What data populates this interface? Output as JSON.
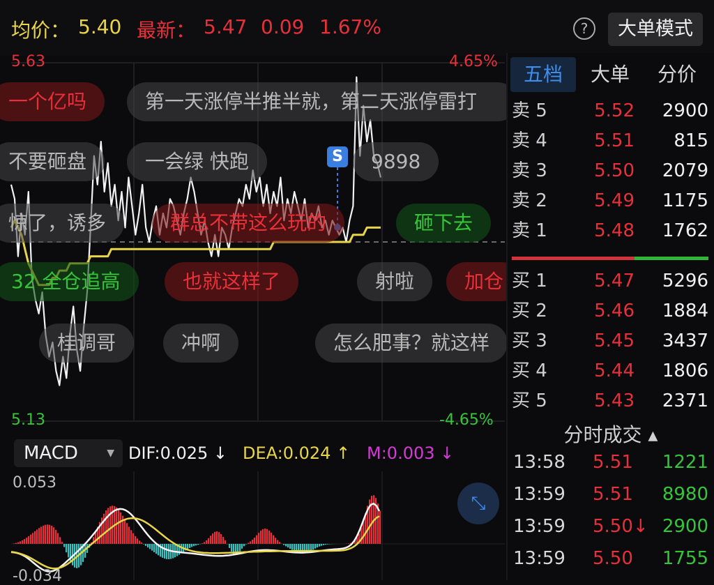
{
  "header": {
    "avg_label": "均价：",
    "avg_value": "5.40",
    "latest_label": "最新：",
    "latest_price": "5.47",
    "change": "0.09",
    "change_pct": "1.67%",
    "help_icon": "?",
    "mode_button": "大单模式"
  },
  "chart_data": {
    "type": "line",
    "price_max": "5.63",
    "price_min": "5.13",
    "pct_max": "4.65%",
    "pct_min": "-4.65%",
    "ylim": [
      5.13,
      5.63
    ],
    "prev_close": 5.38,
    "series": [
      {
        "values": [
          5.46,
          5.44,
          5.36,
          5.42,
          5.39,
          5.45,
          5.33,
          5.3,
          5.28,
          5.31,
          5.25,
          5.22,
          5.24,
          5.2,
          5.18,
          5.22,
          5.19,
          5.25,
          5.29,
          5.23,
          5.2,
          5.26,
          5.31,
          5.4,
          5.5,
          5.46,
          5.52,
          5.45,
          5.49,
          5.43,
          5.46,
          5.41,
          5.45,
          5.4,
          5.47,
          5.43,
          5.39,
          5.42,
          5.46,
          5.4,
          5.38,
          5.41,
          5.43,
          5.39,
          5.42,
          5.4,
          5.44,
          5.43,
          5.41,
          5.39,
          5.42,
          5.44,
          5.47,
          5.45,
          5.42,
          5.39,
          5.41,
          5.38,
          5.36,
          5.39,
          5.36,
          5.4,
          5.39,
          5.37,
          5.4,
          5.42,
          5.44,
          5.43,
          5.46,
          5.44,
          5.48,
          5.45,
          5.47,
          5.43,
          5.46,
          5.42,
          5.45,
          5.43,
          5.47,
          5.41,
          5.44,
          5.42,
          5.45,
          5.43,
          5.41,
          5.44,
          5.4,
          5.42,
          5.41,
          5.43,
          5.4,
          5.41,
          5.39,
          5.41,
          5.4,
          5.39,
          5.4,
          5.38,
          5.41,
          5.43,
          5.61,
          5.5,
          5.57,
          5.52,
          5.55,
          5.5,
          5.49,
          5.47
        ]
      },
      {
        "values": [
          5.4,
          5.41,
          5.4,
          5.39,
          5.37,
          5.35,
          5.34,
          5.33,
          5.32,
          5.32,
          5.32,
          5.32,
          5.33,
          5.33,
          5.34,
          5.34,
          5.34,
          5.35,
          5.35,
          5.35,
          5.35,
          5.35,
          5.35,
          5.36,
          5.36,
          5.36,
          5.36,
          5.36,
          5.36,
          5.37,
          5.37,
          5.37,
          5.37,
          5.37,
          5.37,
          5.37,
          5.37,
          5.37,
          5.37,
          5.37,
          5.37,
          5.37,
          5.37,
          5.37,
          5.37,
          5.37,
          5.37,
          5.37,
          5.37,
          5.37,
          5.37,
          5.37,
          5.37,
          5.37,
          5.37,
          5.37,
          5.37,
          5.37,
          5.37,
          5.37,
          5.37,
          5.37,
          5.37,
          5.37,
          5.37,
          5.37,
          5.37,
          5.37,
          5.37,
          5.37,
          5.37,
          5.37,
          5.37,
          5.37,
          5.37,
          5.37,
          5.38,
          5.38,
          5.38,
          5.38,
          5.38,
          5.38,
          5.38,
          5.38,
          5.38,
          5.38,
          5.38,
          5.38,
          5.38,
          5.38,
          5.38,
          5.38,
          5.38,
          5.38,
          5.38,
          5.38,
          5.38,
          5.38,
          5.38,
          5.39,
          5.39,
          5.39,
          5.39,
          5.4,
          5.4,
          5.4,
          5.4,
          5.4
        ]
      }
    ],
    "grid": true
  },
  "danmaku": [
    {
      "text": "一个亿吗",
      "style": "red"
    },
    {
      "text": "第一天涨停半推半就，第二天涨停雷打",
      "style": "grey"
    },
    {
      "text": "不要砸盘",
      "style": "grey"
    },
    {
      "text": "一会绿 快跑",
      "style": "grey"
    },
    {
      "text": "9898",
      "style": "grey"
    },
    {
      "text": "惊了，诱多",
      "style": "grey"
    },
    {
      "text": "群总不带这么玩的",
      "style": "red"
    },
    {
      "text": "砸下去",
      "style": "green"
    },
    {
      "text": "32 全仓追高",
      "style": "green"
    },
    {
      "text": "也就这样了",
      "style": "red"
    },
    {
      "text": "射啦",
      "style": "grey"
    },
    {
      "text": "加仓",
      "style": "red"
    },
    {
      "text": "桂调哥",
      "style": "grey"
    },
    {
      "text": "冲啊",
      "style": "grey"
    },
    {
      "text": "怎么肥事？就这样",
      "style": "grey"
    }
  ],
  "s_marker": "S",
  "macd": {
    "selector": "MACD",
    "dif": "DIF:0.025 ↓",
    "dea": "DEA:0.024 ↑",
    "m": "M:0.003 ↓",
    "top_value": "0.053",
    "bottom_value": "-0.034",
    "expand_icon": "expand-icon"
  },
  "panel": {
    "tabs": [
      "五档",
      "大单",
      "分价"
    ],
    "asks": [
      {
        "label": "卖 5",
        "price": "5.52",
        "vol": "2900"
      },
      {
        "label": "卖 4",
        "price": "5.51",
        "vol": "815"
      },
      {
        "label": "卖 3",
        "price": "5.50",
        "vol": "2079"
      },
      {
        "label": "卖 2",
        "price": "5.49",
        "vol": "1175"
      },
      {
        "label": "卖 1",
        "price": "5.48",
        "vol": "1762"
      }
    ],
    "bids": [
      {
        "label": "买 1",
        "price": "5.47",
        "vol": "5296"
      },
      {
        "label": "买 2",
        "price": "5.46",
        "vol": "1884"
      },
      {
        "label": "买 3",
        "price": "5.45",
        "vol": "3437"
      },
      {
        "label": "买 4",
        "price": "5.44",
        "vol": "1806"
      },
      {
        "label": "买 5",
        "price": "5.43",
        "vol": "2371"
      }
    ],
    "trades_title": "分时成交 ▴",
    "trades": [
      {
        "time": "13:58",
        "price": "5.51",
        "vol": "1221"
      },
      {
        "time": "13:59",
        "price": "5.51",
        "vol": "8980"
      },
      {
        "time": "13:59",
        "price": "5.50↓",
        "vol": "2900"
      },
      {
        "time": "13:59",
        "price": "5.50",
        "vol": "1755"
      }
    ]
  },
  "colors": {
    "up": "#e8303a",
    "down": "#35c43a",
    "avg": "#e8d648",
    "accent": "#3d8ef0"
  }
}
